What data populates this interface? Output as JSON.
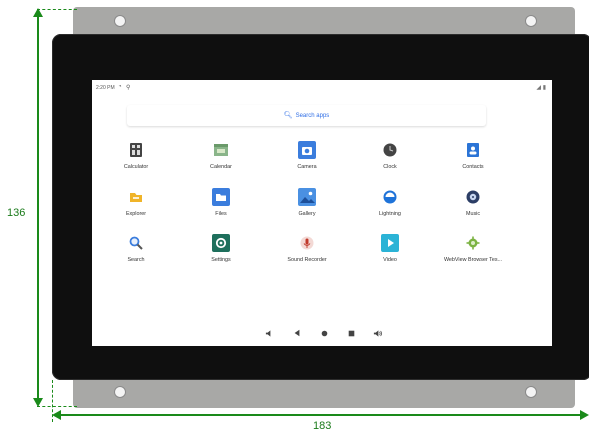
{
  "dimensions": {
    "height_label": "136",
    "width_label": "183"
  },
  "status_bar": {
    "time": "2:20 PM"
  },
  "search": {
    "label": "Search apps"
  },
  "apps": [
    {
      "label": "Calculator",
      "icon": "calculator-icon",
      "color": "#444444"
    },
    {
      "label": "Calendar",
      "icon": "calendar-icon",
      "color": "#8ab58a"
    },
    {
      "label": "Camera",
      "icon": "camera-icon",
      "color": "#3b7ddd"
    },
    {
      "label": "Clock",
      "icon": "clock-icon",
      "color": "#444444"
    },
    {
      "label": "Contacts",
      "icon": "contacts-icon",
      "color": "#2b74d6"
    },
    {
      "label": "Explorer",
      "icon": "folder-icon",
      "color": "#f0b429"
    },
    {
      "label": "Files",
      "icon": "files-icon",
      "color": "#3b7ddd"
    },
    {
      "label": "Gallery",
      "icon": "gallery-icon",
      "color": "#4a90e2"
    },
    {
      "label": "Lightning",
      "icon": "lightning-icon",
      "color": "#1f73d9"
    },
    {
      "label": "Music",
      "icon": "music-icon",
      "color": "#2c3e66"
    },
    {
      "label": "Search",
      "icon": "search-app-icon",
      "color": "#3b7ddd"
    },
    {
      "label": "Settings",
      "icon": "settings-icon",
      "color": "#1e6f5c"
    },
    {
      "label": "Sound Recorder",
      "icon": "microphone-icon",
      "color": "#c0392b"
    },
    {
      "label": "Video",
      "icon": "video-icon",
      "color": "#2bb3d6"
    },
    {
      "label": "WebView Browser Tes...",
      "icon": "android-icon",
      "color": "#7cb342"
    }
  ],
  "navbar": [
    "volume-down-icon",
    "back-icon",
    "home-icon",
    "recents-icon",
    "volume-up-icon"
  ]
}
